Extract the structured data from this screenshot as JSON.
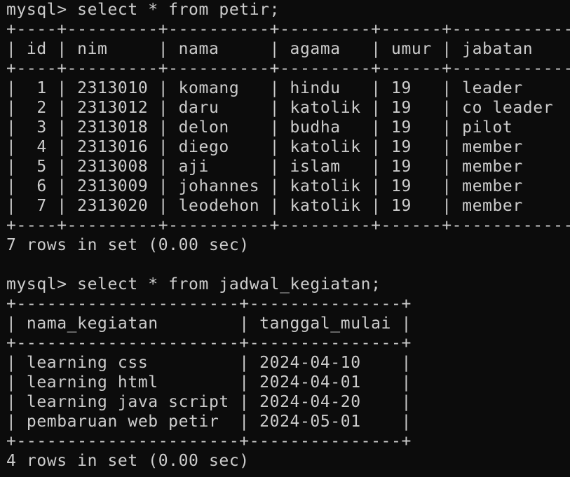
{
  "terminal": {
    "background": "#0c0c0c",
    "foreground": "#cccccc",
    "lines": [
      "mysql> select * from petir;",
      "+----+---------+----------+---------+------+------------+",
      "| id | nim     | nama     | agama   | umur | jabatan    |",
      "+----+---------+----------+---------+------+------------+",
      "|  1 | 2313010 | komang   | hindu   | 19   | leader     |",
      "|  2 | 2313012 | daru     | katolik | 19   | co leader  |",
      "|  3 | 2313018 | delon    | budha   | 19   | pilot      |",
      "|  4 | 2313016 | diego    | katolik | 19   | member     |",
      "|  5 | 2313008 | aji      | islam   | 19   | member     |",
      "|  6 | 2313009 | johannes | katolik | 19   | member     |",
      "|  7 | 2313020 | leodehon | katolik | 19   | member     |",
      "+----+---------+----------+---------+------+------------+",
      "7 rows in set (0.00 sec)",
      "",
      "mysql> select * from jadwal_kegiatan;",
      "+----------------------+---------------+",
      "| nama_kegiatan        | tanggal_mulai |",
      "+----------------------+---------------+",
      "| learning css         | 2024-04-10    |",
      "| learning html        | 2024-04-01    |",
      "| learning java script | 2024-04-20    |",
      "| pembaruan web petir  | 2024-05-01    |",
      "+----------------------+---------------+",
      "4 rows in set (0.00 sec)"
    ]
  }
}
